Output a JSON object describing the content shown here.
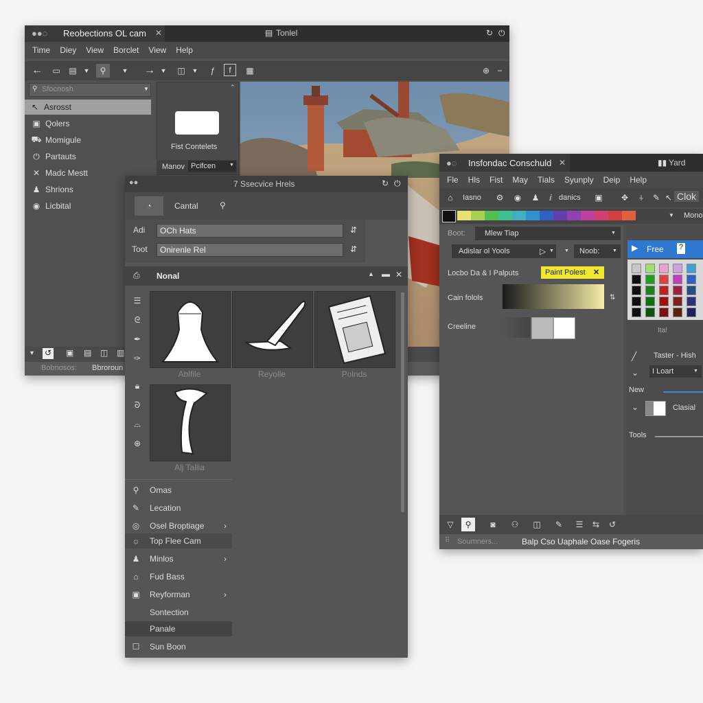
{
  "win1": {
    "title": "Reobections OL cam",
    "title_right": "Tonlel",
    "menus": [
      "Time",
      "Diey",
      "View",
      "Borclet",
      "View",
      "Help"
    ],
    "search_placeholder": "Sfocnosh",
    "sidebar": [
      {
        "label": "Asrosst",
        "icon": "cursor-icon"
      },
      {
        "label": "Qolers",
        "icon": "grid-icon"
      },
      {
        "label": "Momigule",
        "icon": "car-icon"
      },
      {
        "label": "Partauts",
        "icon": "power-icon"
      },
      {
        "label": "Madc Mestt",
        "icon": "cross-icon"
      },
      {
        "label": "Shrions",
        "icon": "figure-icon"
      },
      {
        "label": "Licbital",
        "icon": "globe-icon"
      }
    ],
    "preview_label": "Fist Contelets",
    "mode_label": "Manov",
    "mode_value": "Pcifcen",
    "status_left": "Bobnosos:",
    "status_right": "Bbroroun",
    "colors": {
      "bg": "#505050",
      "title": "#3a3a3a",
      "selected": "#a0a0a0"
    }
  },
  "win2": {
    "title": "7 Ssecvice Hrels",
    "tab_label": "Cantal",
    "fields": [
      {
        "label": "Adi",
        "value": "OCh Hats"
      },
      {
        "label": "Toot",
        "value": "Onirenle Rel"
      }
    ],
    "section_title": "Nonal",
    "thumbs": [
      {
        "label": "Ablfile",
        "icon": "cap-icon"
      },
      {
        "label": "Reyolle",
        "icon": "brush-icon"
      },
      {
        "label": "Polnds",
        "icon": "document-icon"
      },
      {
        "label": "Alj Tallia",
        "icon": "pipe-icon"
      }
    ],
    "list": [
      {
        "label": "Omas",
        "icon": "link-icon"
      },
      {
        "label": "Lecation",
        "icon": "edit-icon"
      },
      {
        "label": "Osel Broptiage",
        "icon": "target-icon",
        "arrow": "›"
      },
      {
        "label": "Top Flee Cam",
        "icon": "sun-icon"
      },
      {
        "label": "Minlos",
        "icon": "figure-icon",
        "arrow": "›"
      },
      {
        "label": "Fud Bass",
        "icon": "lock-icon"
      },
      {
        "label": "Reyforman",
        "icon": "frame-icon",
        "arrow": "›"
      },
      {
        "label": "Sontection",
        "icon": ""
      },
      {
        "label": "Panale",
        "icon": ""
      },
      {
        "label": "Sun Boon",
        "icon": "square-icon"
      }
    ]
  },
  "win3": {
    "title": "Insfondac Conschuld",
    "title_right": "Yard",
    "menus": [
      "Fle",
      "Hls",
      "Fist",
      "May",
      "Tials",
      "Syunply",
      "Deip",
      "Help"
    ],
    "tool_labels": [
      "Iasno",
      "danics"
    ],
    "tool_right": "Clok",
    "mono": "Mono",
    "boot_label": "Boot:",
    "boot_value": "Mlew Tiap",
    "adjust_value": "Adislar ol Yools",
    "noob_value": "Noob:",
    "paint_label": "Locbo Da & I Palputs",
    "paint_tag": "Paint Polest",
    "gradient_label": "Cain folols",
    "creeline_label": "Creeline",
    "free_label": "Free",
    "grid_label": "Ital",
    "taster_label": "Taster - Hish",
    "loart_value": "I Loart",
    "new_label": "New",
    "clasial_label": "Clasial",
    "tools_label": "Tools",
    "status_left": "Soumners...",
    "status_main": "Balp Cso Uaphale Oase Fogeris",
    "palette": [
      "#e8e070",
      "#a8d050",
      "#50c050",
      "#40c090",
      "#40b0c0",
      "#3090d0",
      "#3060c0",
      "#6040b0",
      "#9040b0",
      "#c040a0",
      "#d04070",
      "#d04040",
      "#e06040"
    ],
    "grid_colors": [
      "#c8c8c8",
      "#a0e070",
      "#f0a0d0",
      "#d0a0e0",
      "#40a0d0",
      "#101010",
      "#20a020",
      "#e04040",
      "#c040c0",
      "#3060c0",
      "#101010",
      "#208020",
      "#c02020",
      "#a02040",
      "#205080",
      "#101010",
      "#107010",
      "#a01010",
      "#802020",
      "#303080",
      "#101010",
      "#105010",
      "#801010",
      "#602010",
      "#202060"
    ]
  }
}
